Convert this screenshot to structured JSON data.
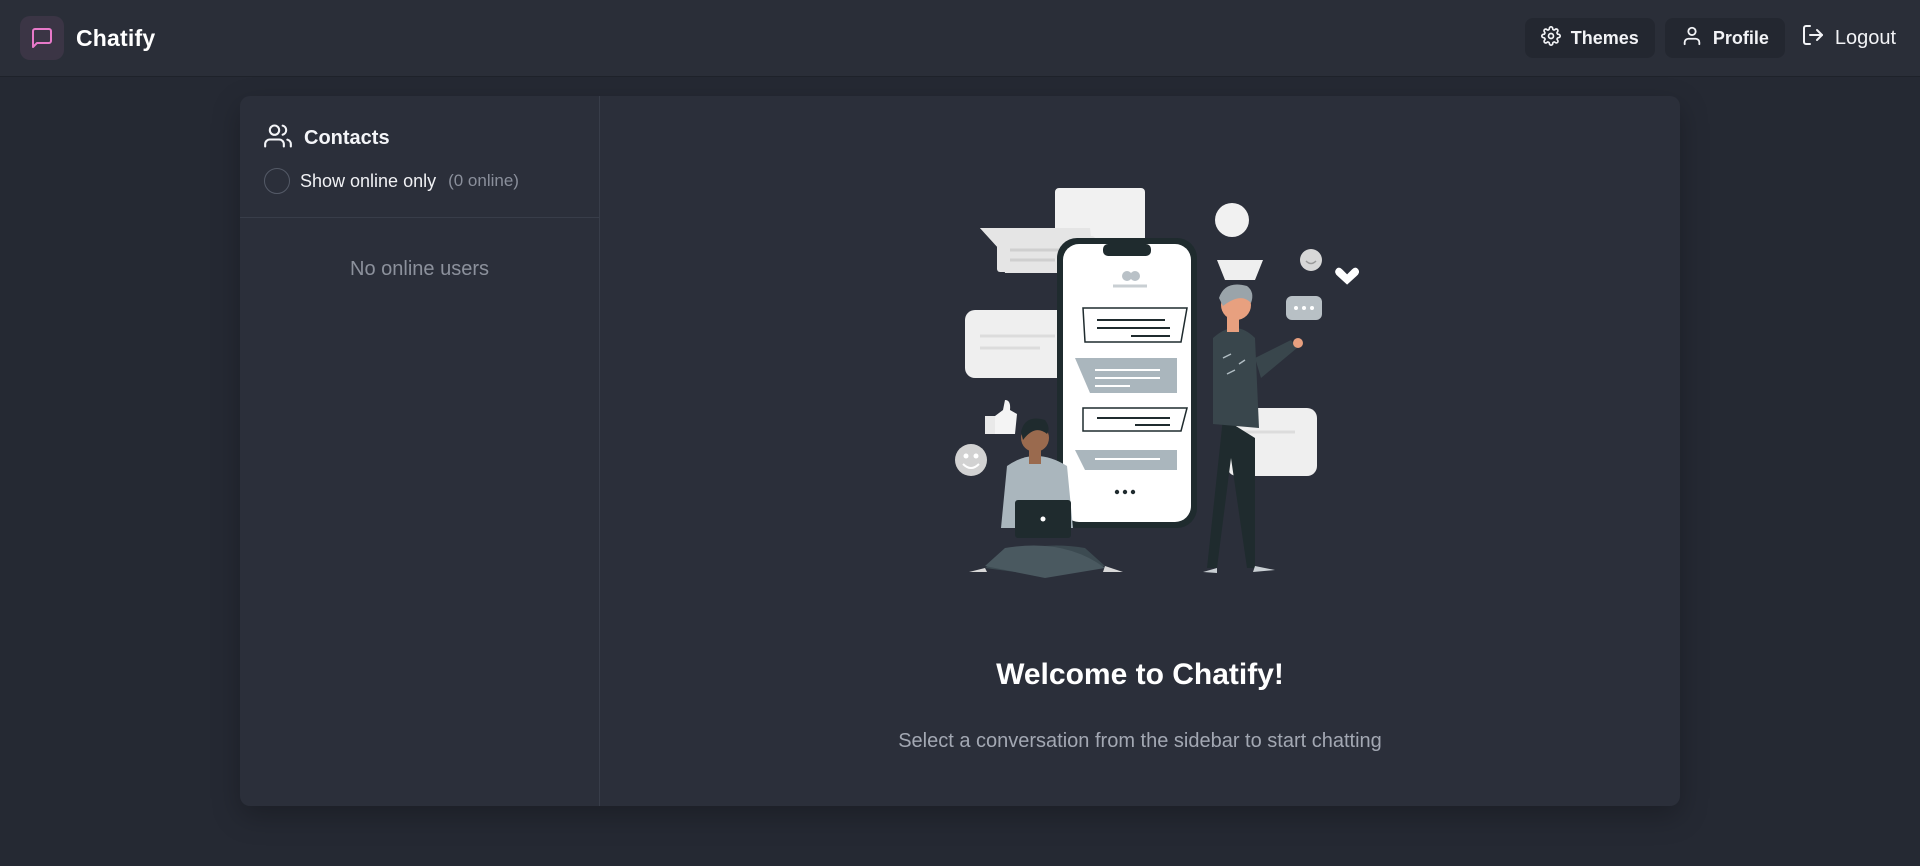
{
  "app": {
    "name": "Chatify",
    "logo_icon": "message-square-icon",
    "accent": "#e879c9"
  },
  "nav": {
    "themes_label": "Themes",
    "profile_label": "Profile",
    "logout_label": "Logout"
  },
  "sidebar": {
    "title": "Contacts",
    "title_icon": "users-icon",
    "toggle_label": "Show online only",
    "online_count_text": "(0 online)",
    "online_only_checked": false,
    "empty_text": "No online users"
  },
  "welcome": {
    "title": "Welcome to Chatify!",
    "subtitle": "Select a conversation from the sidebar to start chatting"
  },
  "colors": {
    "background": "#252933",
    "navbar": "#2a2e38",
    "card": "#2b2f3a"
  }
}
